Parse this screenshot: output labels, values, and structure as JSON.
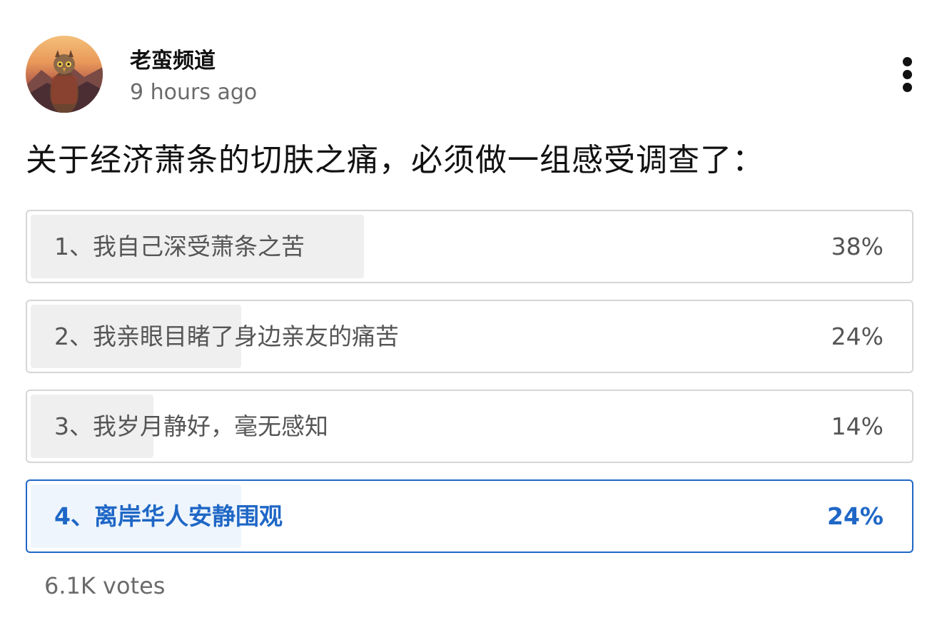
{
  "post": {
    "channel_name": "老蛮频道",
    "timestamp": "9 hours ago",
    "question": "关于经济萧条的切肤之痛，必须做一组感受调查了："
  },
  "poll": {
    "options": [
      {
        "label": "1、我自己深受萧条之苦",
        "percent_text": "38%",
        "percent": 38,
        "selected": false
      },
      {
        "label": "2、我亲眼目睹了身边亲友的痛苦",
        "percent_text": "24%",
        "percent": 24,
        "selected": false
      },
      {
        "label": "3、我岁月静好，毫无感知",
        "percent_text": "14%",
        "percent": 14,
        "selected": false
      },
      {
        "label": "4、离岸华人安静围观",
        "percent_text": "24%",
        "percent": 24,
        "selected": true
      }
    ],
    "votes": "6.1K votes"
  },
  "icons": {
    "more": "more-vertical-icon",
    "avatar": "owl-avatar-image"
  },
  "colors": {
    "accent": "#1f67c6",
    "selected_fill": "#eef5fd",
    "bar_fill": "#efefef",
    "border": "#d6d6d6"
  }
}
